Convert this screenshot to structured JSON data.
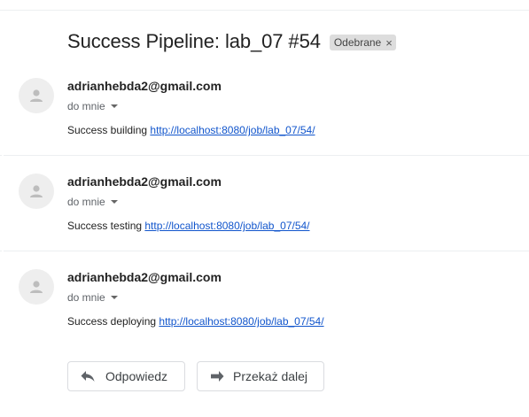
{
  "thread": {
    "subject": "Success Pipeline: lab_07 #54",
    "label": "Odebrane",
    "label_remove_glyph": "×"
  },
  "messages": [
    {
      "sender": "adrianhebda2@gmail.com",
      "recipients": "do mnie",
      "text": "Success building ",
      "link": "http://localhost:8080/job/lab_07/54/"
    },
    {
      "sender": "adrianhebda2@gmail.com",
      "recipients": "do mnie",
      "text": "Success testing ",
      "link": "http://localhost:8080/job/lab_07/54/"
    },
    {
      "sender": "adrianhebda2@gmail.com",
      "recipients": "do mnie",
      "text": "Success deploying ",
      "link": "http://localhost:8080/job/lab_07/54/"
    }
  ],
  "actions": {
    "reply_label": "Odpowiedz",
    "forward_label": "Przekaż dalej",
    "reply_icon": "reply-icon",
    "forward_icon": "forward-icon"
  },
  "colors": {
    "link": "#1155cc",
    "avatar_bg": "#eeeeee",
    "avatar_fg": "#bdbdbd",
    "chip_bg": "#dddddd"
  }
}
